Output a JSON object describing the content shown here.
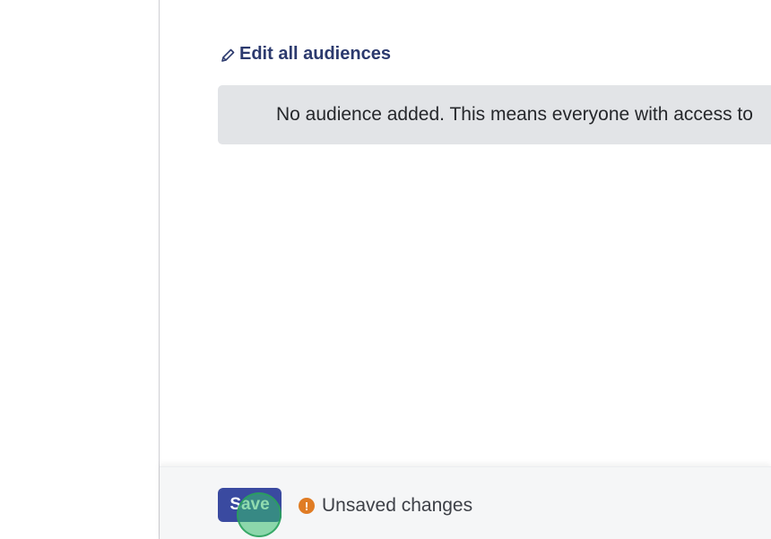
{
  "audiences": {
    "edit_all_label": "Edit all audiences",
    "empty_notice": "No audience added. This means everyone with access to"
  },
  "footer": {
    "save_label": "Save",
    "unsaved_text": "Unsaved changes",
    "warning_icon_glyph": "!"
  },
  "icons": {
    "edit": "pencil-icon",
    "status": "warning-icon"
  },
  "colors": {
    "accent": "#3a4aa0",
    "link": "#2c3a6e",
    "warning": "#e07c24",
    "notice_bg": "#e2e4e7",
    "footer_bg": "#f5f6f7"
  }
}
